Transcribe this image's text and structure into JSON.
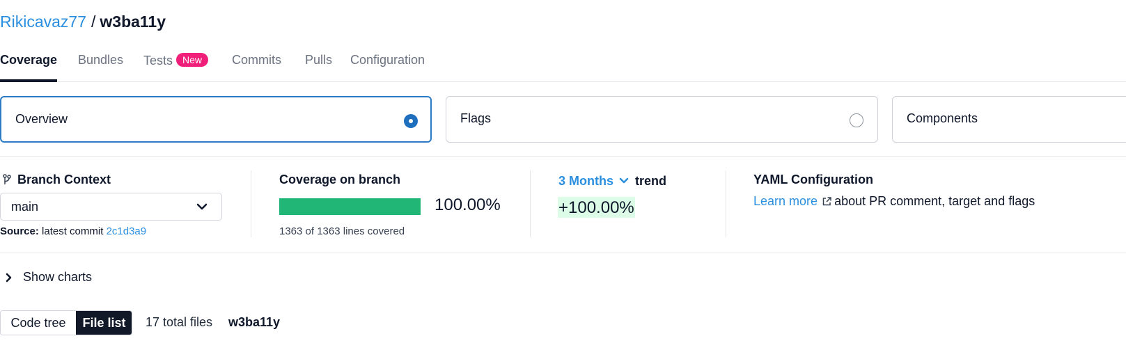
{
  "breadcrumb": {
    "owner": "Rikicavaz77",
    "separator": "/",
    "repo": "w3ba11y"
  },
  "tabs": [
    {
      "label": "Coverage",
      "active": true
    },
    {
      "label": "Bundles"
    },
    {
      "label": "Tests",
      "badge": "New"
    },
    {
      "label": "Commits"
    },
    {
      "label": "Pulls"
    },
    {
      "label": "Configuration"
    }
  ],
  "views": [
    {
      "label": "Overview",
      "selected": true
    },
    {
      "label": "Flags",
      "selected": false
    },
    {
      "label": "Components",
      "selected": false
    }
  ],
  "branch_context": {
    "title": "Branch Context",
    "selected_branch": "main",
    "source_label": "Source:",
    "source_text": "latest commit",
    "commit": "2c1d3a9"
  },
  "coverage": {
    "title": "Coverage on branch",
    "percent_text": "100.00%",
    "percent_value": 100,
    "lines_text": "1363 of 1363 lines covered"
  },
  "trend": {
    "period": "3 Months",
    "label": "trend",
    "value": "+100.00%"
  },
  "yaml": {
    "title": "YAML Configuration",
    "link_text": "Learn more",
    "rest_text": "about PR comment, target and flags"
  },
  "show_charts": "Show charts",
  "file_view": {
    "options": [
      "Code tree",
      "File list"
    ],
    "active": "File list",
    "total_files": "17 total files",
    "repo": "w3ba11y"
  },
  "colors": {
    "accent": "#2b8fe0",
    "coverage_bar": "#21b576",
    "trend_bg": "#dcfce7",
    "badge": "#f01f7a",
    "toggle_active": "#111827"
  },
  "icons": {
    "branch": "git-branch-icon",
    "select_chevron": "chevron-down-icon",
    "trend_chevron": "chevron-down-icon",
    "external": "external-link-icon",
    "show_charts": "chevron-right-icon"
  }
}
